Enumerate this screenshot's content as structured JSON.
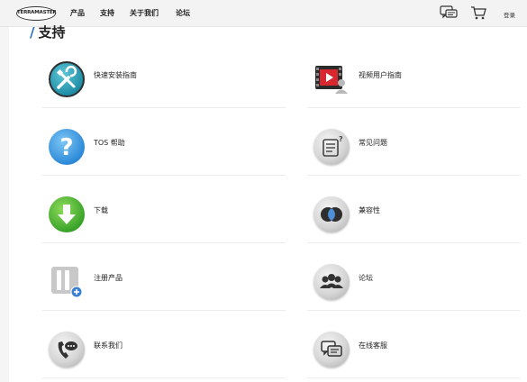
{
  "header": {
    "logo_text": "TERRAMASTER",
    "nav": [
      "产品",
      "支持",
      "关于我们",
      "论坛"
    ],
    "login": "登录"
  },
  "page": {
    "title": "支持"
  },
  "cards": [
    {
      "label": "快速安装指南",
      "icon": "tools-icon"
    },
    {
      "label": "视频用户指南",
      "icon": "video-user-icon"
    },
    {
      "label": "TOS 帮助",
      "icon": "question-icon"
    },
    {
      "label": "常见问题",
      "icon": "faq-icon"
    },
    {
      "label": "下载",
      "icon": "download-icon"
    },
    {
      "label": "兼容性",
      "icon": "compatibility-icon"
    },
    {
      "label": "注册产品",
      "icon": "register-product-icon"
    },
    {
      "label": "论坛",
      "icon": "forum-icon"
    },
    {
      "label": "联系我们",
      "icon": "phone-chat-icon"
    },
    {
      "label": "在线客服",
      "icon": "online-service-icon"
    }
  ]
}
